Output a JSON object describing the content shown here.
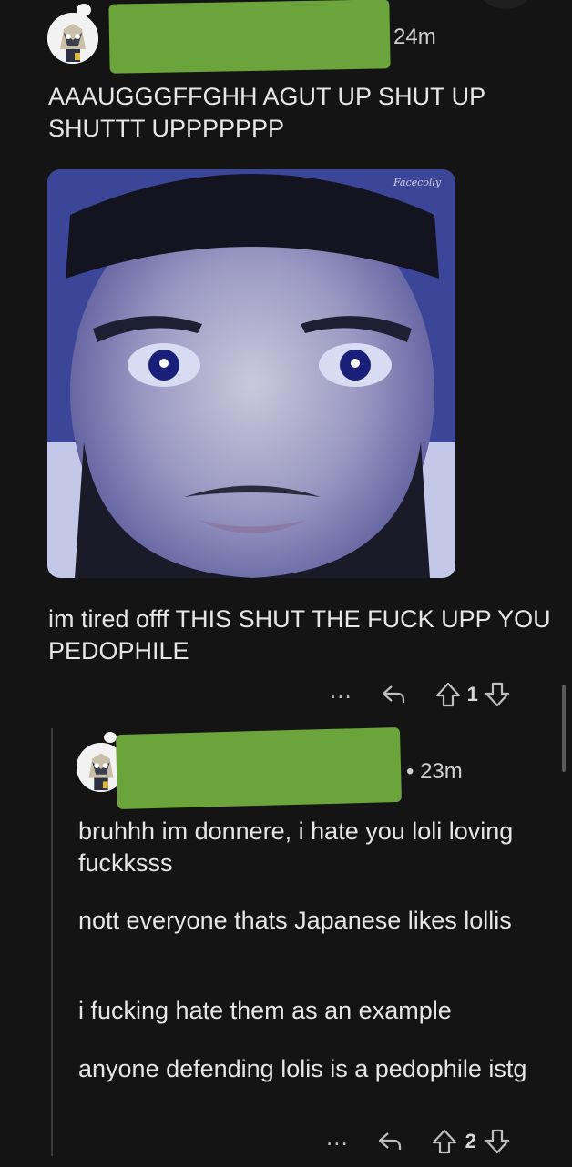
{
  "comment": {
    "timestamp": "24m",
    "paragraphs": [
      "AAAUGGGFFGHH AGUT UP SHUT UP SHUTTT UPPPPPPP",
      "im tired offf THIS SHUT THE FUCK UPP YOU PEDOPHILE"
    ],
    "media_watermark": "Facecolly",
    "more_label": "...",
    "upvotes": "1"
  },
  "reply": {
    "timestamp": "• 23m",
    "paragraphs": [
      "bruhhh im donnere, i hate you loli loving fuckksss",
      "nott everyone thats Japanese likes lollis",
      "i fucking hate them as an example",
      "anyone defending lolis is a pedophile istg"
    ],
    "more_label": "...",
    "upvotes": "2"
  },
  "icons": [
    "avatar-icon",
    "more-icon",
    "reply-icon",
    "upvote-icon",
    "downvote-icon"
  ],
  "colors": {
    "background": "#141414",
    "redaction": "#6aa43a",
    "text": "#e6e6e6"
  }
}
